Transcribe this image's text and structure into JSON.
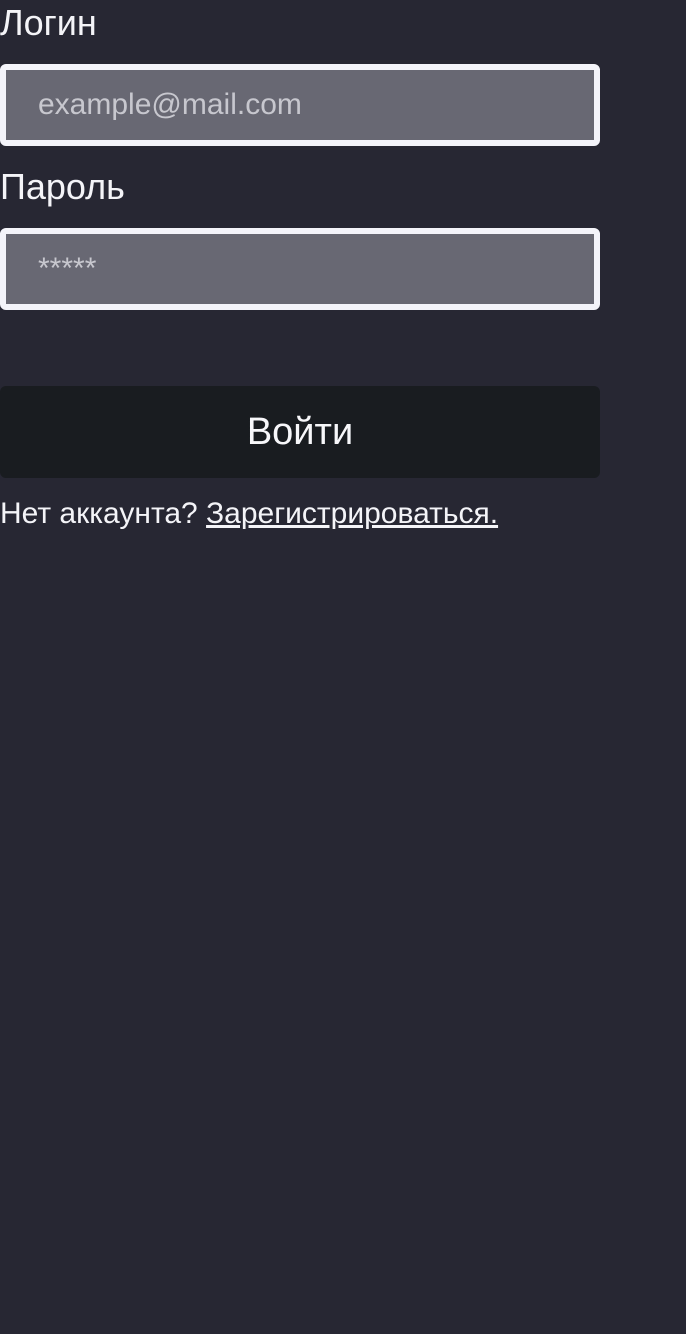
{
  "login_form": {
    "login_label": "Логин",
    "login_placeholder": "example@mail.com",
    "login_value": "",
    "password_label": "Пароль",
    "password_placeholder": "*****",
    "password_value": "",
    "submit_label": "Войти",
    "signup_prompt": "Нет аккаунта?",
    "signup_link_label": "Зарегистрироваться."
  },
  "colors": {
    "background": "#272733",
    "field_background": "#686873",
    "field_border": "#f4f4fa",
    "button_background": "#191c20",
    "text": "#f4f4f8"
  }
}
